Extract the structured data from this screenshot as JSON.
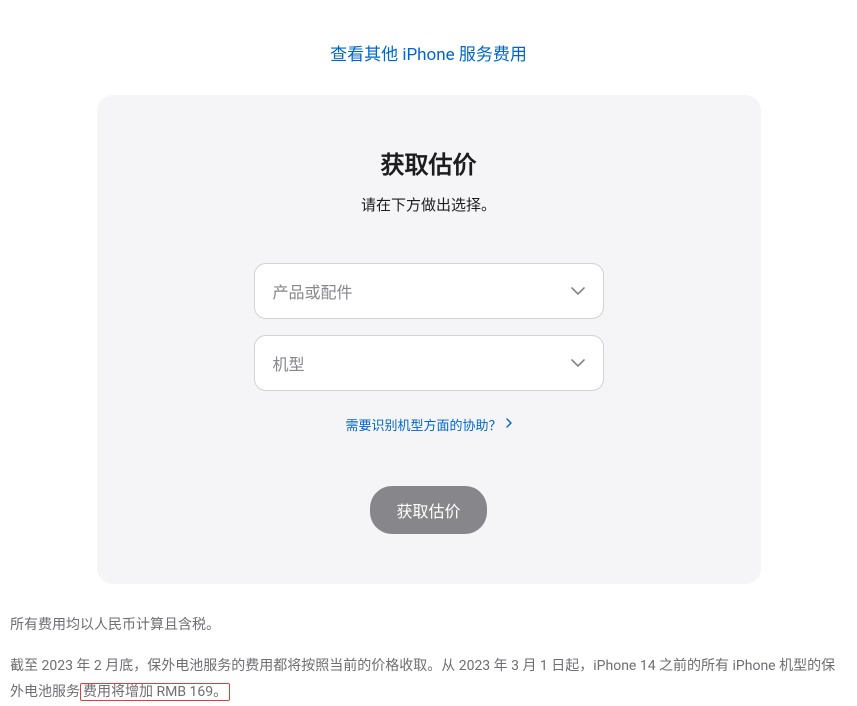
{
  "header": {
    "link_text": "查看其他 iPhone 服务费用"
  },
  "card": {
    "title": "获取估价",
    "subtitle": "请在下方做出选择。",
    "select_product_placeholder": "产品或配件",
    "select_model_placeholder": "机型",
    "help_link_text": "需要识别机型方面的协助？",
    "button_label": "获取估价"
  },
  "footer": {
    "line1": "所有费用均以人民币计算且含税。",
    "line2_part1": "截至 2023 年 2 月底，保外电池服务的费用都将按照当前的价格收取。从 2023 年 3 月 1 日起，iPhone 14 之前的所有 iPhone 机型的保外电池服务",
    "line2_highlight": "费用将增加 RMB 169。"
  }
}
